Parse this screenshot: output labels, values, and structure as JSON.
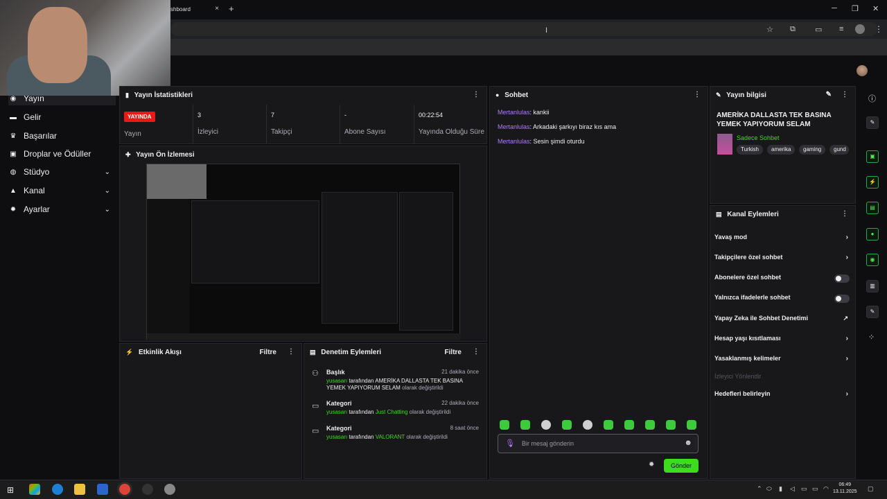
{
  "browser": {
    "tab_title": "shboard",
    "tab_close": "×",
    "new_tab": "+",
    "min": "─",
    "max": "❐",
    "close": "✕"
  },
  "sidebar": {
    "items": [
      {
        "label": "Yayın",
        "icon": "broadcast-icon"
      },
      {
        "label": "Gelir",
        "icon": "revenue-icon"
      },
      {
        "label": "Başarılar",
        "icon": "trophy-icon"
      },
      {
        "label": "Droplar ve Ödüller",
        "icon": "gift-icon"
      },
      {
        "label": "Stüdyo",
        "icon": "studio-icon"
      },
      {
        "label": "Kanal",
        "icon": "channel-icon"
      },
      {
        "label": "Ayarlar",
        "icon": "gear-icon"
      }
    ]
  },
  "stream_stats": {
    "title": "Yayın İstatistikleri",
    "live_badge": "YAYINDA",
    "live_label": "Yayın",
    "viewers_value": "3",
    "viewers_label": "İzleyici",
    "followers_value": "7",
    "followers_label": "Takipçi",
    "subs_value": "-",
    "subs_label": "Abone Sayısı",
    "uptime_value": "00:22:54",
    "uptime_label": "Yayında Olduğu Süre"
  },
  "preview": {
    "title": "Yayın Ön İzlemesi"
  },
  "activity": {
    "title": "Etkinlik Akışı",
    "filter": "Filtre"
  },
  "audit": {
    "title": "Denetim Eylemleri",
    "filter": "Filtre",
    "rows": [
      {
        "type": "Başlık",
        "time": "21 dakika önce",
        "user": "yusasarı",
        "mid": " tarafından ",
        "value": "AMERİKA DALLASTA TEK BASINA YEMEK YAPIYORUM SELAM",
        "end": " olarak değiştirildi"
      },
      {
        "type": "Kategori",
        "time": "22 dakika önce",
        "user": "yusasarı",
        "mid": " tarafından ",
        "value": "Just Chatting",
        "end": " olarak değiştirildi"
      },
      {
        "type": "Kategori",
        "time": "8 saat önce",
        "user": "yusasarı",
        "mid": " tarafından ",
        "value": "VALORANT",
        "end": " olarak değiştirildi"
      }
    ]
  },
  "chat": {
    "title": "Sohbet",
    "messages": [
      {
        "user": "Mertanlulas",
        "text": ": kankii"
      },
      {
        "user": "Mertanlulas",
        "text": ": Arkadaki şarkıyı biraz kıs ama"
      },
      {
        "user": "Mertanlulas",
        "text": ": Sesin şimdi oturdu"
      }
    ],
    "placeholder": "Bir mesaj gönderin",
    "send": "Gönder"
  },
  "stream_info": {
    "title": "Yayın bilgisi",
    "stream_title": "AMERİKA DALLASTA TEK BASINA YEMEK YAPIYORUM SELAM",
    "category": "Sadece Sohbet",
    "tags": [
      "Turkish",
      "amerika",
      "gaming",
      "gund"
    ]
  },
  "channel_actions": {
    "title": "Kanal Eylemleri",
    "items": [
      {
        "label": "Yavaş mod",
        "kind": "arrow"
      },
      {
        "label": "Takipçilere özel sohbet",
        "kind": "arrow"
      },
      {
        "label": "Abonelere özel sohbet",
        "kind": "toggle"
      },
      {
        "label": "Yalnızca ifadelerle sohbet",
        "kind": "toggle"
      },
      {
        "label": "Yapay Zeka ile Sohbet Denetimi",
        "kind": "external"
      },
      {
        "label": "Hesap yaşı kısıtlaması",
        "kind": "arrow"
      },
      {
        "label": "Yasaklanmış kelimeler",
        "kind": "arrow"
      },
      {
        "label": "İzleyici Yönlendir",
        "kind": "disabled"
      },
      {
        "label": "Hedefleri belirleyin",
        "kind": "arrow"
      }
    ]
  },
  "taskbar": {
    "time": "06:49",
    "date": "13.11.2025"
  }
}
